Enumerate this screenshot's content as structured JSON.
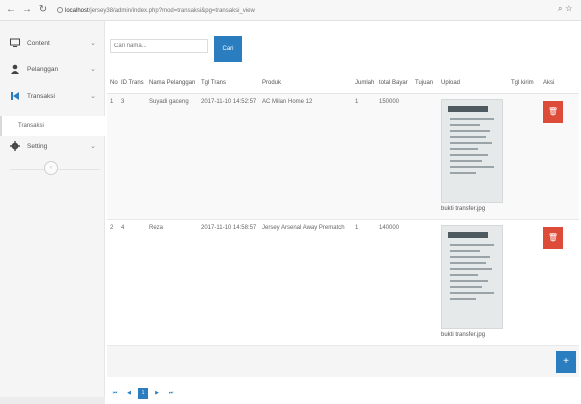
{
  "browser": {
    "url_host": "localhost",
    "url_path": "/jersey38/admin/index.php?mod=transaksi&pg=transaksi_view",
    "back_icon": "arrow-left-icon",
    "forward_icon": "arrow-right-icon",
    "reload_icon": "reload-icon"
  },
  "sidebar": {
    "items": [
      {
        "label": "Content",
        "icon": "monitor-icon"
      },
      {
        "label": "Pelanggan",
        "icon": "user-icon"
      },
      {
        "label": "Transaksi",
        "icon": "skip-back-icon"
      },
      {
        "label": "Setting",
        "icon": "gear-icon"
      }
    ],
    "subitem": "Transaksi",
    "collapse_icon": "circle-chevron-icon"
  },
  "search": {
    "placeholder": "Cari nama...",
    "button_label": "Cari"
  },
  "table": {
    "headers": [
      "No",
      "ID Trans",
      "Nama Pelanggan",
      "Tgl Trans",
      "Produk",
      "Jumlah",
      "total Bayar",
      "Tujuan",
      "Upload",
      "Tgl kirim",
      "Aksi"
    ],
    "rows": [
      {
        "no": "1",
        "id": "3",
        "nama": "Suyadi gaceng",
        "tgl": "2017-11-10 14:52:57",
        "produk": "AC Milan Home 12",
        "jumlah": "1",
        "total": "150000",
        "tujuan": "",
        "upload": "bukti transfer.jpg",
        "tgl_kirim": ""
      },
      {
        "no": "2",
        "id": "4",
        "nama": "Reza",
        "tgl": "2017-11-10 14:58:57",
        "produk": "Jersey Arsenal Away Prematch",
        "jumlah": "1",
        "total": "140000",
        "tujuan": "",
        "upload": "bukti transfer.jpg",
        "tgl_kirim": ""
      }
    ],
    "delete_icon": "trash-icon",
    "add_icon": "plus-icon"
  },
  "pagination": {
    "first": "⏮",
    "prev": "◀",
    "current": "1",
    "next": "▶",
    "last": "⏭"
  },
  "colors": {
    "primary": "#2a7ebf",
    "danger": "#dd4b39",
    "sidebar_bg": "#f5f5f5"
  }
}
